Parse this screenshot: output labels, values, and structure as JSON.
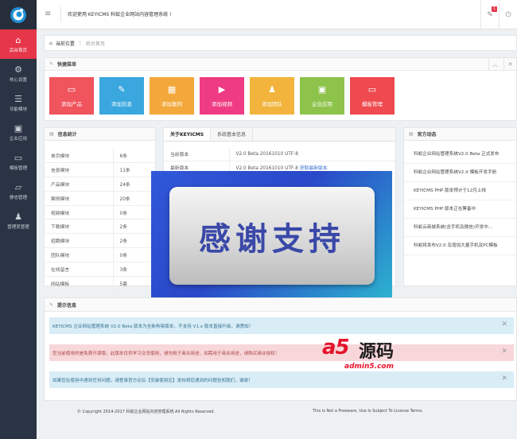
{
  "topbar": {
    "welcome": "欢迎使用 KEYICMS 科蚁企业网站内容管理系统 !",
    "badge": "1"
  },
  "sidebar": {
    "items": [
      {
        "label": "后台首页",
        "icon": "home-icon"
      },
      {
        "label": "核心设置",
        "icon": "gears-icon"
      },
      {
        "label": "功能模块",
        "icon": "list-icon"
      },
      {
        "label": "企业应用",
        "icon": "briefcase-icon"
      },
      {
        "label": "模板管理",
        "icon": "monitor-icon"
      },
      {
        "label": "静态管理",
        "icon": "folder-icon"
      },
      {
        "label": "管理员管理",
        "icon": "user-icon"
      }
    ]
  },
  "breadcrumb": {
    "home": "当前位置",
    "current": "后台首页"
  },
  "quick": {
    "title": "快捷菜单",
    "buttons": [
      {
        "label": "添加产品",
        "color": "#f0545c"
      },
      {
        "label": "添加信息",
        "color": "#3aa7de"
      },
      {
        "label": "添加案例",
        "color": "#f3a83b"
      },
      {
        "label": "添加视频",
        "color": "#ef3b83"
      },
      {
        "label": "添加团队",
        "color": "#f2b43c"
      },
      {
        "label": "企业应用",
        "color": "#8dc34a"
      },
      {
        "label": "模板管理",
        "color": "#ee4a4f"
      }
    ]
  },
  "info": {
    "title": "信息统计",
    "rows": [
      {
        "k": "单页模块",
        "v": "6条"
      },
      {
        "k": "信息模块",
        "v": "11条"
      },
      {
        "k": "产品模块",
        "v": "24条"
      },
      {
        "k": "案例模块",
        "v": "20条"
      },
      {
        "k": "视频模块",
        "v": "0条"
      },
      {
        "k": "下载模块",
        "v": "2条"
      },
      {
        "k": "招聘模块",
        "v": "2条"
      },
      {
        "k": "团队模块",
        "v": "0条"
      },
      {
        "k": "在线留言",
        "v": "3条"
      },
      {
        "k": "网站模板",
        "v": "5套"
      }
    ]
  },
  "about": {
    "tab1": "关于KEYICMS",
    "tab2": "系统基本信息",
    "rows": [
      {
        "k": "当前版本",
        "v": "V2.0 Beta 20161010 UTF-8"
      },
      {
        "k": "最新版本",
        "v": "V2.0 Beta 20161010 UTF-8",
        "link": "获取最新版本"
      }
    ]
  },
  "news": {
    "title": "官方动态",
    "items": [
      "科蚁企业网站管理系统V2.0 Beta 正式发布",
      "科蚁企业网站管理系统V2.X 模板开发手册",
      "KEYICMS PHP 版本预计于12月上线",
      "KEYICMS PHP 版本正在筹备中",
      "科蚁云商城系统(含手机及微信)开发中...",
      "科蚁将发布V2.0 及增加大量手机及PC模板"
    ]
  },
  "overlay": {
    "text": "感谢支持"
  },
  "tips": {
    "title": "提示信息",
    "alerts": [
      {
        "text": "KEYICMS 企业网站管理系统 V2.0 Beta 版本为全新构架版本，不支持 V1.x 版本直接升级，请悉知！",
        "bg": "#d9edf7",
        "color": "#31708f"
      },
      {
        "text": "您当前使用的是免费开源版，此版本仅供学习交流使用，请勿用于商业用途，如需用于商业用途，请购买商业授权！",
        "bg": "#f8d7da",
        "color": "#a94442"
      },
      {
        "text": "如果您在使用中遇到任何问题，请登录官方论坛【安装使用区】发帖将您遇到的问题告知我们，谢谢！",
        "bg": "#d9edf7",
        "color": "#31708f"
      }
    ]
  },
  "footer": {
    "left": "© Copyright 2014-2017 科蚁企业网站内容管理系统 All Rights Reserved.",
    "right": "This Is Not a Freeware, Use Is Subject To License Terms."
  },
  "watermark": {
    "brand": "a5",
    "cn": "源码",
    "url": "admin5.com"
  }
}
